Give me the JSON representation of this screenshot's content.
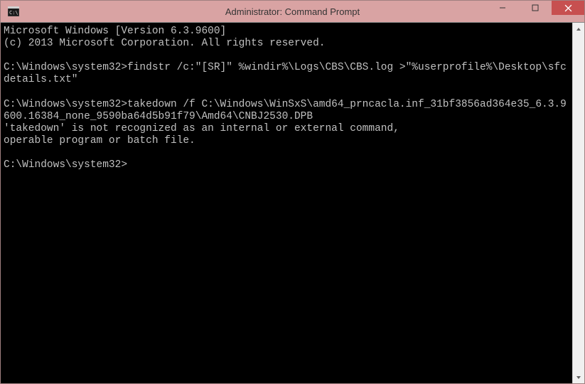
{
  "window": {
    "title": "Administrator: Command Prompt"
  },
  "terminal": {
    "lines": [
      "Microsoft Windows [Version 6.3.9600]",
      "(c) 2013 Microsoft Corporation. All rights reserved.",
      "",
      "C:\\Windows\\system32>findstr /c:\"[SR]\" %windir%\\Logs\\CBS\\CBS.log >\"%userprofile%\\Desktop\\sfcdetails.txt\"",
      "",
      "C:\\Windows\\system32>takedown /f C:\\Windows\\WinSxS\\amd64_prncacla.inf_31bf3856ad364e35_6.3.9600.16384_none_9590ba64d5b91f79\\Amd64\\CNBJ2530.DPB",
      "'takedown' is not recognized as an internal or external command,",
      "operable program or batch file.",
      "",
      "C:\\Windows\\system32>"
    ]
  }
}
